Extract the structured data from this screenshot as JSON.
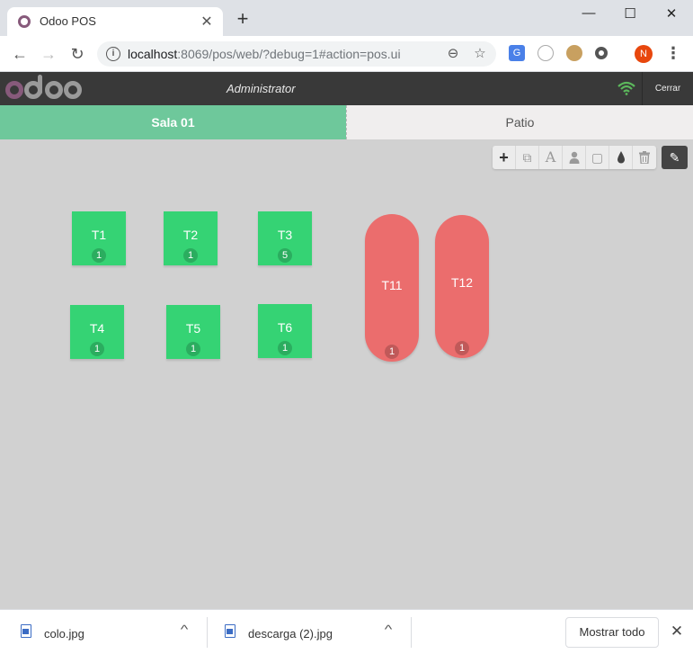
{
  "browser": {
    "tab_title": "Odoo POS",
    "tab_close": "✕",
    "new_tab": "+",
    "minimize": "—",
    "maximize": "☐",
    "close": "✕",
    "back": "←",
    "forward": "→",
    "reload": "↻",
    "url_host": "localhost",
    "url_rest": ":8069/pos/web/?debug=1#action=pos.ui",
    "zoom_icon": "⊖",
    "bookmark_icon": "☆",
    "profile_initial": "N",
    "menu": "⋮"
  },
  "header": {
    "user": "Administrator",
    "close_label": "Cerrar",
    "wifi_color": "#5cb85c"
  },
  "floors": [
    {
      "label": "Sala 01",
      "active": true
    },
    {
      "label": "Patio",
      "active": false
    }
  ],
  "edit_tools": [
    {
      "name": "add-table-icon",
      "glyph": "+"
    },
    {
      "name": "duplicate-icon",
      "glyph": "⧉"
    },
    {
      "name": "rename-icon",
      "glyph": "A"
    },
    {
      "name": "seats-icon",
      "glyph": "👤"
    },
    {
      "name": "shape-icon",
      "glyph": "▢"
    },
    {
      "name": "color-icon",
      "glyph": "💧"
    },
    {
      "name": "trash-icon",
      "glyph": "🗑"
    }
  ],
  "edit_toggle_glyph": "✎",
  "tables": [
    {
      "name": "T1",
      "seats": "1",
      "shape": "square"
    },
    {
      "name": "T2",
      "seats": "1",
      "shape": "square"
    },
    {
      "name": "T3",
      "seats": "5",
      "shape": "square"
    },
    {
      "name": "T4",
      "seats": "1",
      "shape": "square"
    },
    {
      "name": "T5",
      "seats": "1",
      "shape": "square"
    },
    {
      "name": "T6",
      "seats": "1",
      "shape": "square"
    },
    {
      "name": "T11",
      "seats": "1",
      "shape": "round"
    },
    {
      "name": "T12",
      "seats": "1",
      "shape": "round"
    }
  ],
  "colors": {
    "square_table": "#35d374",
    "round_table": "#eb6d6d",
    "active_floor": "#6ec89b"
  },
  "downloads": {
    "files": [
      {
        "name": "colo.jpg"
      },
      {
        "name": "descarga (2).jpg"
      }
    ],
    "chevron": "^",
    "show_all": "Mostrar todo",
    "close": "✕"
  }
}
